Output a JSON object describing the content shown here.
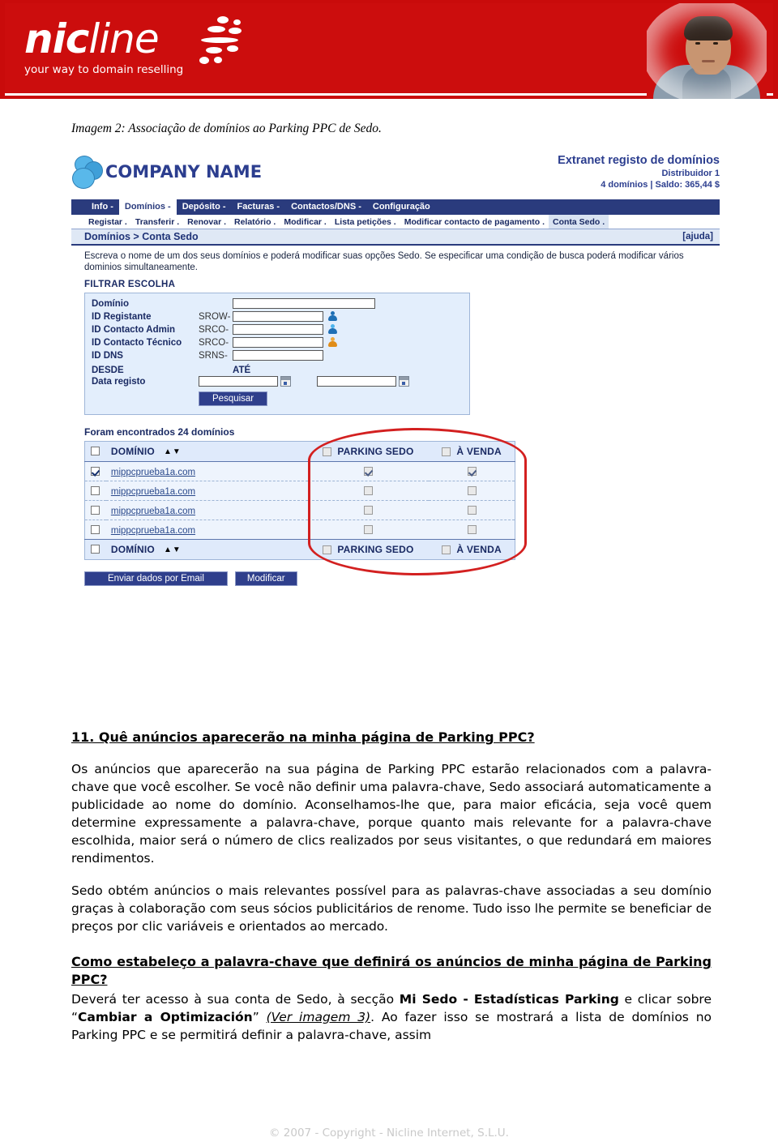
{
  "banner": {
    "logo_main_bold": "nic",
    "logo_main_thin": "line",
    "tagline": "your way to domain reselling",
    "brand_red": "#cc0d0d"
  },
  "caption": "Imagem 2: Associação de domínios ao Parking PPC de Sedo.",
  "app": {
    "company_name": "COMPANY NAME",
    "extranet": {
      "title": "Extranet registo de domínios",
      "distributor": "Distribuidor 1",
      "balance": "4 domínios | Saldo: 365,44 $"
    },
    "nav": [
      {
        "label": "Info -",
        "active": false
      },
      {
        "label": "Domínios -",
        "active": true
      },
      {
        "label": "Depósito -",
        "active": false
      },
      {
        "label": "Facturas -",
        "active": false
      },
      {
        "label": "Contactos/DNS -",
        "active": false
      },
      {
        "label": "Configuração",
        "active": false
      }
    ],
    "subnav": [
      {
        "label": "Registar .",
        "selected": false
      },
      {
        "label": "Transferir .",
        "selected": false
      },
      {
        "label": "Renovar .",
        "selected": false
      },
      {
        "label": "Relatório .",
        "selected": false
      },
      {
        "label": "Modificar .",
        "selected": false
      },
      {
        "label": "Lista petições .",
        "selected": false
      },
      {
        "label": "Modificar contacto de pagamento .",
        "selected": false
      },
      {
        "label": "Conta Sedo .",
        "selected": true
      }
    ],
    "breadcrumb": "Domínios > Conta Sedo",
    "help_link": "[ajuda]",
    "intro": "Escreva o nome de um dos seus domínios e poderá modificar suas opções Sedo. Se especificar uma condição de busca poderá modificar vários dominios simultaneamente.",
    "filter": {
      "section_title": "FILTRAR ESCOLHA",
      "rows": [
        {
          "label": "Domínio",
          "prefix": "",
          "value": ""
        },
        {
          "label": "ID Registante",
          "prefix": "SROW-",
          "value": ""
        },
        {
          "label": "ID Contacto Admin",
          "prefix": "SRCO-",
          "value": ""
        },
        {
          "label": "ID Contacto Técnico",
          "prefix": "SRCO-",
          "value": ""
        },
        {
          "label": "ID DNS",
          "prefix": "SRNS-",
          "value": ""
        }
      ],
      "date_from_label": "DESDE",
      "date_to_label": "ATÉ",
      "date_row_label": "Data registo",
      "date_from_value": "",
      "date_to_value": "",
      "search_button": "Pesquisar"
    },
    "results": {
      "found_text": "Foram encontrados 24 domínios",
      "columns": {
        "domain": "DOMÍNIO",
        "parking": "PARKING SEDO",
        "forsale": "À VENDA"
      },
      "sort_arrows": "▲▼",
      "header_checkbox_checked": false,
      "header_parking_checked": false,
      "header_forsale_checked": false,
      "rows": [
        {
          "selected": true,
          "domain": "mippcprueba1a.com",
          "parking": true,
          "forsale": true
        },
        {
          "selected": false,
          "domain": "mippcprueba1a.com",
          "parking": false,
          "forsale": false
        },
        {
          "selected": false,
          "domain": "mippcprueba1a.com",
          "parking": false,
          "forsale": false
        },
        {
          "selected": false,
          "domain": "mippcprueba1a.com",
          "parking": false,
          "forsale": false
        }
      ]
    },
    "buttons": {
      "email": "Enviar dados por Email",
      "modify": "Modificar"
    }
  },
  "doc": {
    "q11_heading": "11. Quê anúncios aparecerão na minha página de Parking PPC?",
    "p1": "Os anúncios que aparecerão na sua página de Parking PPC estarão relacionados com a palavra-chave que você escolher. Se você não definir uma palavra-chave, Sedo associará automaticamente a publicidade ao nome do domínio. Aconselhamos-lhe que, para maior eficácia, seja você quem determine expressamente a palavra-chave, porque quanto mais relevante for a palavra-chave escolhida, maior será o número de clics realizados por seus visitantes, o que redundará em maiores rendimentos.",
    "p2": "Sedo obtém anúncios o mais relevantes possível para as palavras-chave associadas a seu domínio graças à colaboração com seus sócios publicitários de renome. Tudo isso lhe permite se beneficiar de preços por clic variáveis e orientados ao mercado.",
    "q12_heading": "Como estabeleço a palavra-chave que definirá os anúncios de minha página de Parking PPC?",
    "p3_part1": "Deverá ter acesso à sua conta de Sedo, à secção ",
    "p3_bold1": "Mi Sedo - Estadísticas Parking",
    "p3_part2": " e clicar sobre “",
    "p3_bold2": "Cambiar a Optimización",
    "p3_part3": "” ",
    "p3_italic": "(Ver imagem 3)",
    "p3_part4": ". Ao fazer isso se mostrará a lista de domínios no Parking PPC e se permitirá definir a palavra-chave, assim"
  },
  "footer": "© 2007 - Copyright - Nicline Internet, S.L.U."
}
